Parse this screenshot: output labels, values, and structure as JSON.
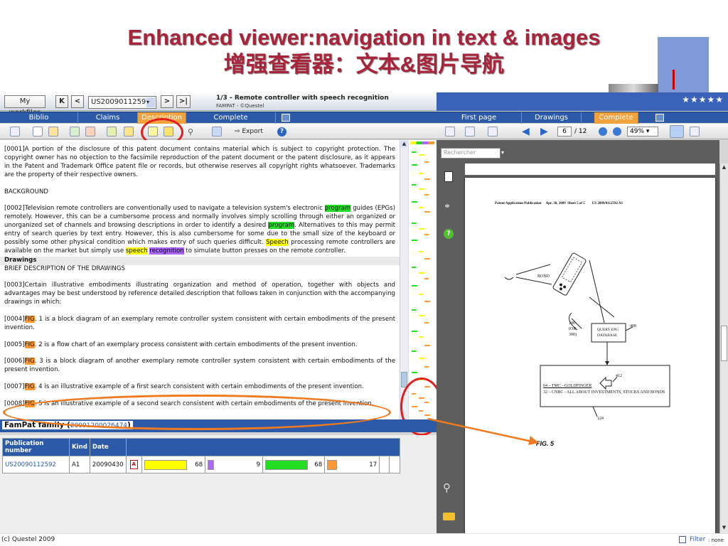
{
  "slide": {
    "title_en": "Enhanced viewer:navigation in text & images",
    "title_zh": "增强查看器：文本&图片导航"
  },
  "header": {
    "my_workfiles": "My workfiles",
    "nav_first": "K",
    "nav_prev": "<",
    "doc_selector": "US20090112592",
    "nav_next": ">",
    "nav_last": ">|",
    "doc_title": "1/3 - Remote controller with speech recognition",
    "doc_subtitle": "FAMPAT - ©Questel",
    "stars": "★★★★★"
  },
  "left_tabs": [
    {
      "label": "Biblio"
    },
    {
      "label": "Claims"
    },
    {
      "label": "Description"
    },
    {
      "label": "Complete"
    }
  ],
  "right_tabs": [
    {
      "label": "First page"
    },
    {
      "label": "Drawings"
    },
    {
      "label": "Complete"
    }
  ],
  "left_toolbar": {
    "export_label": "Export"
  },
  "right_toolbar": {
    "page_current": "6",
    "page_total": "/ 12",
    "zoom": "49%"
  },
  "search": {
    "placeholder": "Rechercher"
  },
  "description": {
    "p1": "[0001]A portion of the disclosure of this patent document contains material which is subject to copyright protection. The copyright owner has no objection to the facsimile reproduction of the patent document or the patent disclosure, as it appears in the Patent and Trademark Office patent file or records, but otherwise reserves all copyright rights whatsoever. Trademarks are the property of their respective owners.",
    "background": "BACKGROUND",
    "p2_a": "[0002]Television remote controllers are conventionally used to navigate a television system's electronic ",
    "p2_hl1": "program",
    "p2_b": " guides (EPGs) remotely. However, this can be a cumbersome process and normally involves simply scrolling through either an organized or unorganized set of channels and browsing descriptions in order to identify a desired ",
    "p2_hl2": "program",
    "p2_c": ". Alternatives to this may permit entry of search queries by text entry. However, this is also cumbersome for some due to the small size of the keyboard or possibly some other physical condition which makes entry of such queries difficult. ",
    "p2_hl3": "Speech",
    "p2_d": " processing remote controllers are available on the market but simply use ",
    "p2_hl4": "speech",
    "p2_e": " ",
    "p2_hl5": "recognition",
    "p2_f": " to simulate button presses on the remote controller.",
    "drawings": "Drawings",
    "brief": "BRIEF DESCRIPTION OF THE DRAWINGS",
    "p3": "[0003]Certain illustrative embodiments illustrating organization and method of operation, together with objects and advantages may be best understood by reference detailed description that follows taken in conjunction with the accompanying drawings in which:",
    "fig_word": "FIG",
    "p4_pre": "[0004]",
    "p4": ". 1 is a block diagram of an exemplary remote controller system consistent with certain embodiments of the present invention.",
    "p5_pre": "[0005]",
    "p5": ". 2 is a flow chart of an exemplary process consistent with certain embodiments of the present invention.",
    "p6_pre": "[0006]",
    "p6": ". 3 is a block diagram of another exemplary remote controller system consistent with certain embodiments of the present invention.",
    "p7_pre": "[0007]",
    "p7": ". 4 is an illustrative example of a first search consistent with certain embodiments of the present invention.",
    "p8_pre": "[0008]",
    "p8": ". 5 is an illustrative example of a second search consistent with certain embodiments of the present invention."
  },
  "fampat": {
    "label": "FamPat family (",
    "family_id": "20091200026474",
    "close": ")",
    "columns": [
      "Publication number",
      "Kind",
      "Date"
    ],
    "row": {
      "pub": "US20090112592",
      "kind": "A1",
      "date": "20090430",
      "c1": "68",
      "c2": "9",
      "c3": "68",
      "c4": "17"
    },
    "colors": {
      "yellow": "#ffff00",
      "purple": "#aa66ff",
      "green": "#22dd22",
      "orange": "#ff9933"
    }
  },
  "patent_page": {
    "header": "Patent Application Publication     Apr. 30, 2009  Sheet 5 of 5        US 2009/0112592 A1",
    "bond": "BOND",
    "ref100": "100",
    "ref_or": "(OR",
    "ref300": "300)",
    "ref408": "408",
    "query1": "QUERY EPG",
    "query2": "DATABASE",
    "ref412": "412",
    "line1": "64 – TMC - GOLDFINGER",
    "line2": "32 – CNBC - ALL ABOUT INVESTMENTS, STOCKS AND BONDS",
    "ref124": "124",
    "fig": "FIG. 5"
  },
  "footer": {
    "copyright": "(c) Questel 2009",
    "filter": "Filter",
    "filter_value": ": none"
  }
}
